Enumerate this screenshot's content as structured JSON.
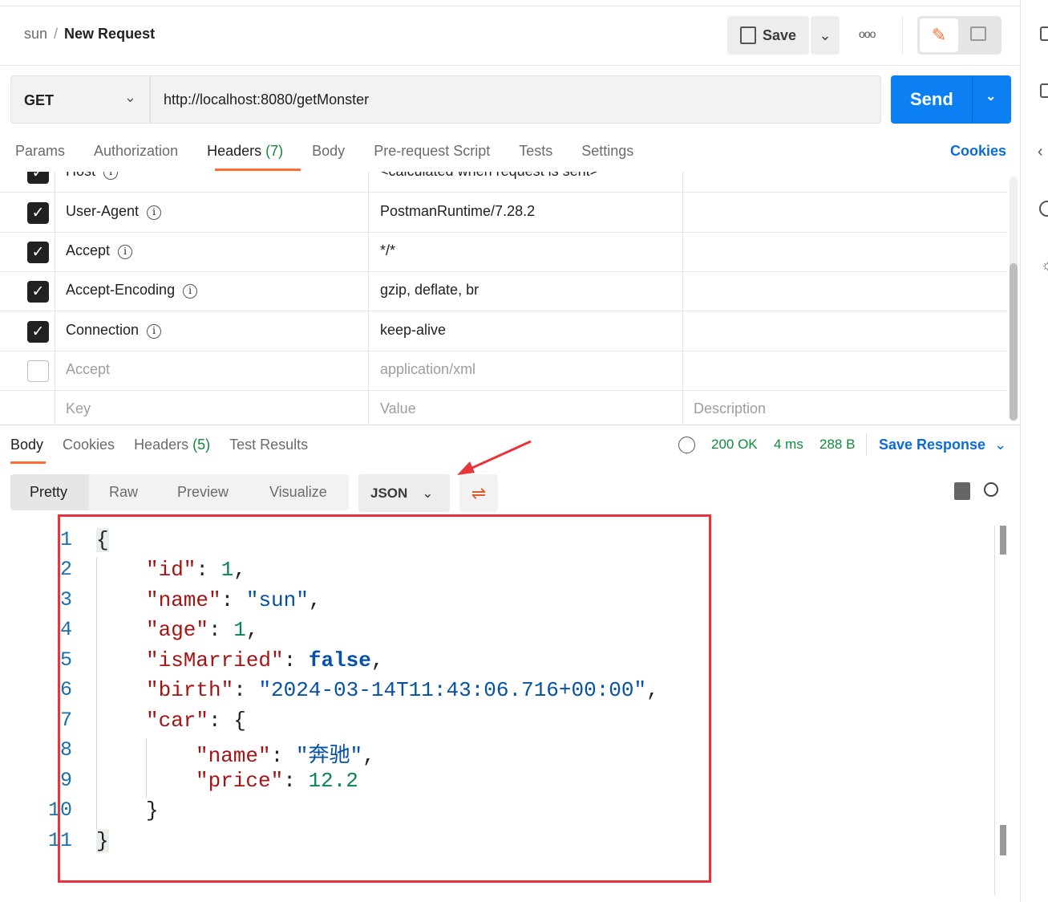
{
  "breadcrumb": {
    "collection": "sun",
    "separator": "/",
    "request": "New Request"
  },
  "toolbar": {
    "save_label": "Save",
    "more_icon": "ellipsis-icon",
    "save_icon": "floppy-icon"
  },
  "request": {
    "method": "GET",
    "url": "http://localhost:8080/getMonster",
    "send_label": "Send"
  },
  "request_tabs": [
    {
      "label": "Params"
    },
    {
      "label": "Authorization"
    },
    {
      "label": "Headers",
      "count": "(7)",
      "active": true
    },
    {
      "label": "Body"
    },
    {
      "label": "Pre-request Script"
    },
    {
      "label": "Tests"
    },
    {
      "label": "Settings"
    }
  ],
  "cookies_label": "Cookies",
  "headers": [
    {
      "key": "Host",
      "value": "<calculated when request is sent>",
      "checked": true
    },
    {
      "key": "User-Agent",
      "value": "PostmanRuntime/7.28.2",
      "checked": true
    },
    {
      "key": "Accept",
      "value": "*/*",
      "checked": true
    },
    {
      "key": "Accept-Encoding",
      "value": "gzip, deflate, br",
      "checked": true
    },
    {
      "key": "Connection",
      "value": "keep-alive",
      "checked": true
    },
    {
      "key": "Accept",
      "value": "application/xml",
      "checked": false
    }
  ],
  "headers_placeholder": {
    "key": "Key",
    "value": "Value",
    "description": "Description"
  },
  "response_tabs": [
    {
      "label": "Body",
      "active": true
    },
    {
      "label": "Cookies"
    },
    {
      "label": "Headers",
      "count": "(5)"
    },
    {
      "label": "Test Results"
    }
  ],
  "response_status": {
    "status": "200 OK",
    "time": "4 ms",
    "size": "288 B",
    "save_label": "Save Response"
  },
  "view_modes": [
    "Pretty",
    "Raw",
    "Preview",
    "Visualize"
  ],
  "format": "JSON",
  "accent_color": "#ff6c37",
  "send_color": "#0c7ff2",
  "annotation_color": "#e8343a",
  "code_lines": [
    "1",
    "2",
    "3",
    "4",
    "5",
    "6",
    "7",
    "8",
    "9",
    "10",
    "11"
  ],
  "code": {
    "id_key": "\"id\"",
    "id_val": "1",
    "name_key": "\"name\"",
    "name_val": "\"sun\"",
    "age_key": "\"age\"",
    "age_val": "1",
    "married_key": "\"isMarried\"",
    "married_val": "false",
    "birth_key": "\"birth\"",
    "birth_val": "\"2024-03-14T11:43:06.716+00:00\"",
    "car_key": "\"car\"",
    "car_name_key": "\"name\"",
    "car_name_val": "\"奔驰\"",
    "price_key": "\"price\"",
    "price_val": "12.2"
  }
}
